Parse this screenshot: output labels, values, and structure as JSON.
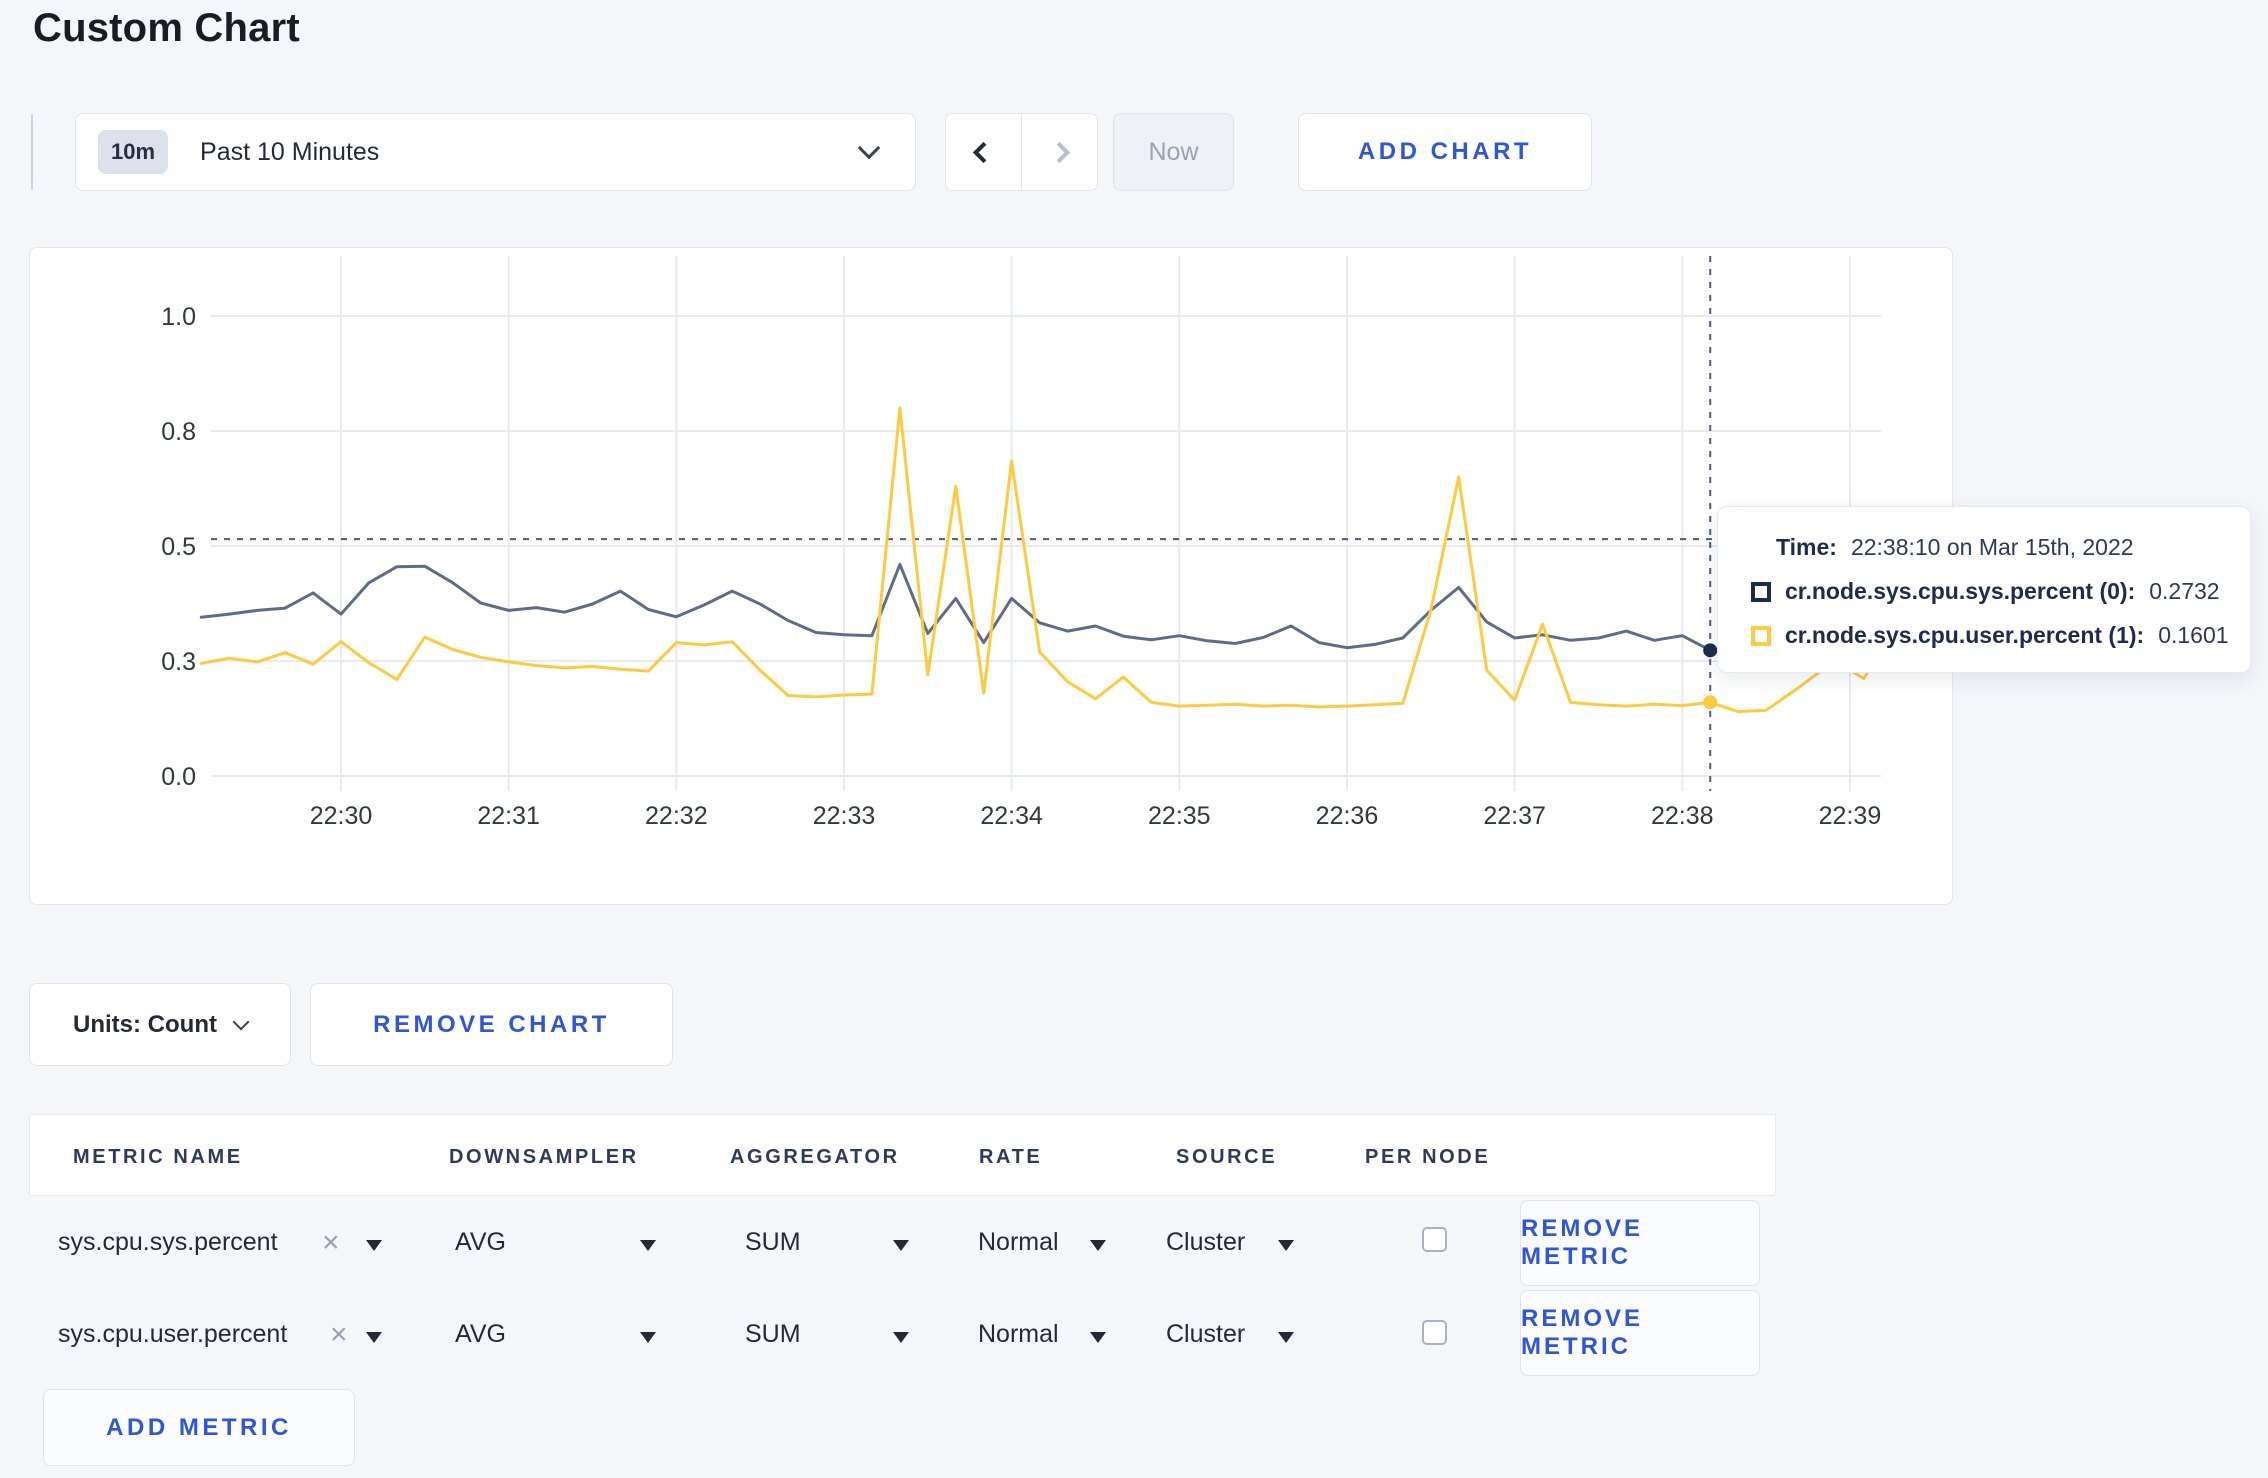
{
  "page": {
    "title": "Custom Chart"
  },
  "toolbar": {
    "range_badge": "10m",
    "range_label": "Past 10 Minutes",
    "prev": "previous time window",
    "next": "next time window",
    "now_label": "Now",
    "add_chart_label": "ADD CHART"
  },
  "colors": {
    "accent_blue": "#2f56d8",
    "navy": "#1c2b4a",
    "grid": "#e9eaec",
    "crosshair": "#4c5b77",
    "axis_text": "#33373d"
  },
  "chart_data": {
    "type": "line",
    "title": "",
    "xlabel": "",
    "ylabel": "",
    "grid": true,
    "legend_position": "tooltip",
    "x_axis": {
      "tick_labels": [
        "22:30",
        "22:31",
        "22:32",
        "22:33",
        "22:34",
        "22:35",
        "22:36",
        "22:37",
        "22:38",
        "22:39"
      ],
      "tick_minutes": [
        0,
        1,
        2,
        3,
        4,
        5,
        6,
        7,
        8,
        9
      ]
    },
    "y_axis": {
      "range": [
        0,
        1
      ],
      "tick_values": [
        0,
        0.25,
        0.5,
        0.75,
        1.0
      ],
      "tick_labels": [
        "0.0",
        "0.3",
        "0.5",
        "0.8",
        "1.0"
      ]
    },
    "series": [
      {
        "name": "cr.node.sys.cpu.sys.percent",
        "color": "#5f6c87",
        "marker_color": "#1c2b4a",
        "points": [
          [
            -50,
            0.345
          ],
          [
            -40,
            0.352
          ],
          [
            -30,
            0.36
          ],
          [
            -20,
            0.365
          ],
          [
            -10,
            0.398
          ],
          [
            0,
            0.352
          ],
          [
            10,
            0.42
          ],
          [
            20,
            0.455
          ],
          [
            30,
            0.456
          ],
          [
            40,
            0.42
          ],
          [
            50,
            0.376
          ],
          [
            60,
            0.36
          ],
          [
            70,
            0.366
          ],
          [
            80,
            0.356
          ],
          [
            90,
            0.374
          ],
          [
            100,
            0.402
          ],
          [
            110,
            0.362
          ],
          [
            120,
            0.346
          ],
          [
            130,
            0.372
          ],
          [
            140,
            0.402
          ],
          [
            150,
            0.374
          ],
          [
            160,
            0.338
          ],
          [
            170,
            0.312
          ],
          [
            180,
            0.307
          ],
          [
            190,
            0.305
          ],
          [
            200,
            0.46
          ],
          [
            210,
            0.31
          ],
          [
            220,
            0.386
          ],
          [
            230,
            0.29
          ],
          [
            240,
            0.386
          ],
          [
            250,
            0.333
          ],
          [
            260,
            0.315
          ],
          [
            270,
            0.326
          ],
          [
            280,
            0.304
          ],
          [
            290,
            0.296
          ],
          [
            300,
            0.305
          ],
          [
            310,
            0.294
          ],
          [
            320,
            0.288
          ],
          [
            330,
            0.301
          ],
          [
            340,
            0.326
          ],
          [
            350,
            0.29
          ],
          [
            360,
            0.279
          ],
          [
            370,
            0.286
          ],
          [
            380,
            0.3
          ],
          [
            390,
            0.36
          ],
          [
            400,
            0.41
          ],
          [
            410,
            0.335
          ],
          [
            420,
            0.3
          ],
          [
            430,
            0.307
          ],
          [
            440,
            0.295
          ],
          [
            450,
            0.3
          ],
          [
            460,
            0.315
          ],
          [
            470,
            0.295
          ],
          [
            480,
            0.305
          ],
          [
            490,
            0.2732
          ],
          [
            500,
            0.262
          ]
        ]
      },
      {
        "name": "cr.node.sys.cpu.user.percent",
        "color": "#fdca40",
        "marker_color": "#fdca40",
        "points": [
          [
            -50,
            0.245
          ],
          [
            -40,
            0.256
          ],
          [
            -30,
            0.248
          ],
          [
            -20,
            0.268
          ],
          [
            -10,
            0.243
          ],
          [
            0,
            0.292
          ],
          [
            10,
            0.246
          ],
          [
            20,
            0.21
          ],
          [
            30,
            0.302
          ],
          [
            40,
            0.275
          ],
          [
            50,
            0.258
          ],
          [
            60,
            0.248
          ],
          [
            70,
            0.24
          ],
          [
            80,
            0.235
          ],
          [
            90,
            0.238
          ],
          [
            100,
            0.232
          ],
          [
            110,
            0.228
          ],
          [
            120,
            0.29
          ],
          [
            130,
            0.285
          ],
          [
            140,
            0.292
          ],
          [
            150,
            0.23
          ],
          [
            160,
            0.175
          ],
          [
            170,
            0.172
          ],
          [
            180,
            0.176
          ],
          [
            190,
            0.178
          ],
          [
            200,
            0.8
          ],
          [
            210,
            0.22
          ],
          [
            220,
            0.63
          ],
          [
            230,
            0.18
          ],
          [
            240,
            0.685
          ],
          [
            250,
            0.27
          ],
          [
            260,
            0.205
          ],
          [
            270,
            0.168
          ],
          [
            280,
            0.215
          ],
          [
            290,
            0.16
          ],
          [
            300,
            0.152
          ],
          [
            310,
            0.154
          ],
          [
            320,
            0.156
          ],
          [
            330,
            0.152
          ],
          [
            340,
            0.154
          ],
          [
            350,
            0.15
          ],
          [
            360,
            0.152
          ],
          [
            370,
            0.155
          ],
          [
            380,
            0.158
          ],
          [
            390,
            0.36
          ],
          [
            400,
            0.65
          ],
          [
            410,
            0.23
          ],
          [
            420,
            0.165
          ],
          [
            430,
            0.33
          ],
          [
            440,
            0.16
          ],
          [
            450,
            0.155
          ],
          [
            460,
            0.152
          ],
          [
            470,
            0.156
          ],
          [
            480,
            0.153
          ],
          [
            490,
            0.1601
          ],
          [
            500,
            0.14
          ],
          [
            510,
            0.143
          ],
          [
            520,
            0.185
          ],
          [
            530,
            0.23
          ],
          [
            535,
            0.248
          ],
          [
            545,
            0.212
          ],
          [
            551,
            0.272
          ]
        ]
      }
    ],
    "crosshair": {
      "time_sec": 490,
      "hover_value": 0.515,
      "marker_values": [
        0.2732,
        0.1601
      ]
    }
  },
  "tooltip": {
    "time_label": "Time:",
    "time_value": "22:38:10 on Mar 15th, 2022",
    "rows": [
      {
        "name": "cr.node.sys.cpu.sys.percent (0):",
        "value": "0.2732",
        "color": "#1c2b4a"
      },
      {
        "name": "cr.node.sys.cpu.user.percent (1):",
        "value": "0.1601",
        "color": "#fdca40"
      }
    ]
  },
  "chart_footer": {
    "units_label": "Units: Count",
    "remove_chart_label": "REMOVE CHART"
  },
  "metrics_table": {
    "headers": [
      "METRIC NAME",
      "DOWNSAMPLER",
      "AGGREGATOR",
      "RATE",
      "SOURCE",
      "PER NODE"
    ],
    "rows": [
      {
        "metric": "sys.cpu.sys.percent",
        "downsampler": "AVG",
        "aggregator": "SUM",
        "rate": "Normal",
        "source": "Cluster",
        "per_node_checked": false,
        "remove_label": "REMOVE METRIC"
      },
      {
        "metric": "sys.cpu.user.percent",
        "downsampler": "AVG",
        "aggregator": "SUM",
        "rate": "Normal",
        "source": "Cluster",
        "per_node_checked": false,
        "remove_label": "REMOVE METRIC"
      }
    ],
    "add_metric_label": "ADD METRIC"
  }
}
